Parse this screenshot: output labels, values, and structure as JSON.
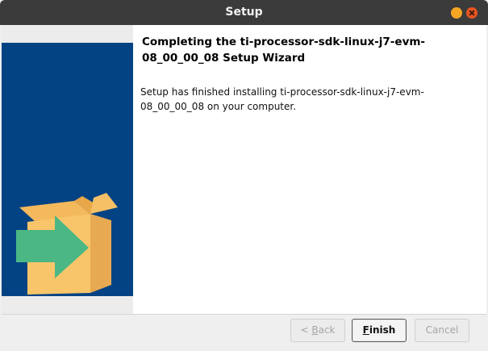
{
  "window": {
    "title": "Setup"
  },
  "colors": {
    "sidebar_blue": "#034384",
    "box_yellow": "#f9c56a",
    "arrow_green": "#4bb784"
  },
  "icons": {
    "illustration": "installer-box-arrow-icon",
    "minimize": "minimize-icon",
    "close": "close-icon"
  },
  "wizard": {
    "heading": "Completing the ti-processor-sdk-linux-j7-evm-08_00_00_08 Setup Wizard",
    "message": "Setup has finished installing ti-processor-sdk-linux-j7-evm-08_00_00_08 on your computer."
  },
  "buttons": {
    "back": {
      "mnemonic": "B",
      "rest": "ack",
      "prefix": "< ",
      "enabled": false
    },
    "finish": {
      "mnemonic": "F",
      "rest": "inish",
      "enabled": true
    },
    "cancel": {
      "label": "Cancel",
      "enabled": false
    }
  }
}
